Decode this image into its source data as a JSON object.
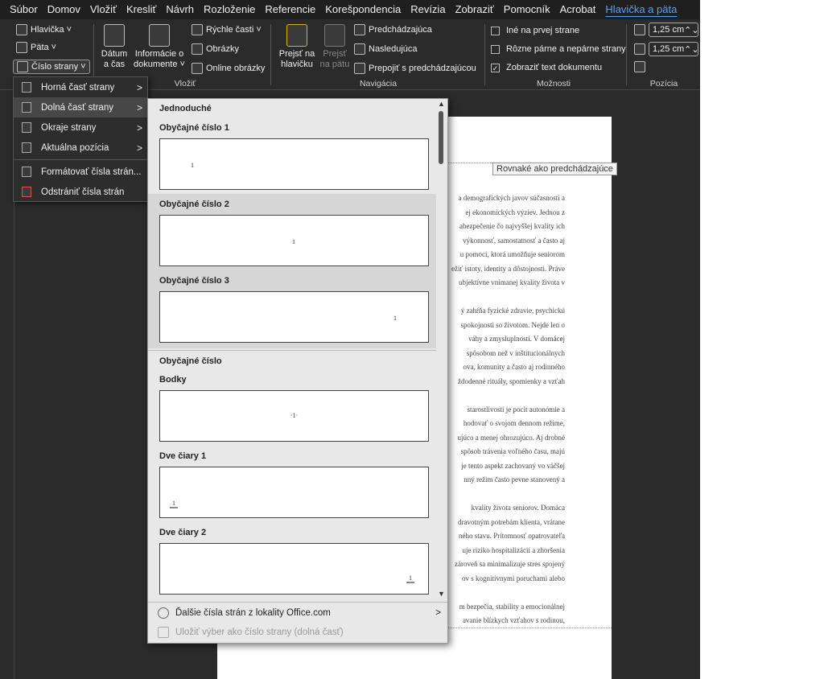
{
  "menubar": {
    "tabs": [
      "Súbor",
      "Domov",
      "Vložiť",
      "Kresliť",
      "Návrh",
      "Rozloženie",
      "Referencie",
      "Korešpondencia",
      "Revízia",
      "Zobraziť",
      "Pomocník",
      "Acrobat",
      "Hlavička a päta"
    ],
    "active": "Hlavička a päta"
  },
  "ribbon": {
    "hf": {
      "header": "Hlavička ˅",
      "footer": "Päta ˅",
      "pagenum": "Číslo strany ˅"
    },
    "insert": {
      "date_l1": "Dátum",
      "date_l2": "a čas",
      "docinfo_l1": "Informácie o",
      "docinfo_l2": "dokumente ˅",
      "quick": "Rýchle časti ˅",
      "pictures": "Obrázky",
      "online": "Online obrázky",
      "group": "Vložiť"
    },
    "nav": {
      "goto_header_l1": "Prejsť na",
      "goto_header_l2": "hlavičku",
      "goto_footer_l1": "Prejsť",
      "goto_footer_l2": "na pätu",
      "previous": "Predchádzajúca",
      "next": "Nasledujúca",
      "link": "Prepojiť s predchádzajúcou",
      "group": "Navigácia"
    },
    "options": {
      "diff_first": "Iné na prvej strane",
      "diff_oddeven": "Rôzne párne a nepárne strany",
      "show_text": "Zobraziť text dokumentu",
      "show_text_checked": "✓",
      "group": "Možnosti"
    },
    "position": {
      "header_pos": "1,25 cm",
      "footer_pos": "1,25 cm",
      "spin": "⌃⌄",
      "group": "Pozícia"
    }
  },
  "submenu": {
    "items": [
      {
        "label": "Horná časť strany",
        "arrow": ">"
      },
      {
        "label": "Dolná časť strany",
        "arrow": ">"
      },
      {
        "label": "Okraje strany",
        "arrow": ">"
      },
      {
        "label": "Aktuálna pozícia",
        "arrow": ">"
      },
      {
        "label": "Formátovať čísla strán..."
      },
      {
        "label": "Odstrániť čísla strán"
      }
    ]
  },
  "gallery": {
    "section_simple": "Jednoduché",
    "plain1": "Obyčajné číslo 1",
    "plain2": "Obyčajné číslo 2",
    "plain3": "Obyčajné číslo 3",
    "section_plain": "Obyčajné číslo",
    "dots": "Bodky",
    "twolines1": "Dve čiary 1",
    "twolines2": "Dve čiary 2",
    "sample_num": "1",
    "dots_sample": "·1·",
    "more": "Ďalšie čísla strán z lokality Office.com",
    "more_arrow": ">",
    "save": "Uložiť výber ako číslo strany (dolná časť)",
    "scroll_up": "▲",
    "scroll_down": "▼"
  },
  "document": {
    "header_tag": "Rovnaké ako predchádzajúce",
    "lines": [
      "a demografických javov súčasnosti a",
      "ej ekonomických výziev. Jednou z",
      "abezpečenie čo najvyššej kvality ich",
      "výkonnosť, samostatnosť a často aj",
      "u pomoci, ktorá umožňuje seniorom",
      "ežiť istoty, identity a dôstojnosti. Práve",
      "ubjektívne vnímanej kvality života v",
      "",
      "ý zahŕňa fyzické zdravie, psychickú",
      "spokojnosti so životom. Nejde len o",
      "váhy a zmysluplnosti. V domácej",
      "spôsobom než v inštitucionálnych",
      "ova, komunity a často aj rodinného",
      "ždodenné rituály, spomienky a vzťah",
      "",
      "starostlivosti je pocit autonómie a",
      "hodovať o svojom dennom režime,",
      "ujúco a menej ohrozujúco. Aj drobné",
      "spôsob trávenia voľného času, majú",
      "je tento aspekt zachovaný vo väčšej",
      "nný režim často pevne stanovený a",
      "",
      "kvality života seniorov. Domáca",
      "dravotným potrebám klienta, vrátane",
      "ného stavu. Prítomnosť opatrovateľa",
      "uje riziko hospitalizácií a zhoršenia",
      "zároveň sa minimalizuje stres spojený",
      "ov s kognitívnymi poruchami alebo",
      "",
      "m bezpečia, stability a emocionálnej",
      "avanie blízkych vzťahov s rodinou,"
    ]
  }
}
